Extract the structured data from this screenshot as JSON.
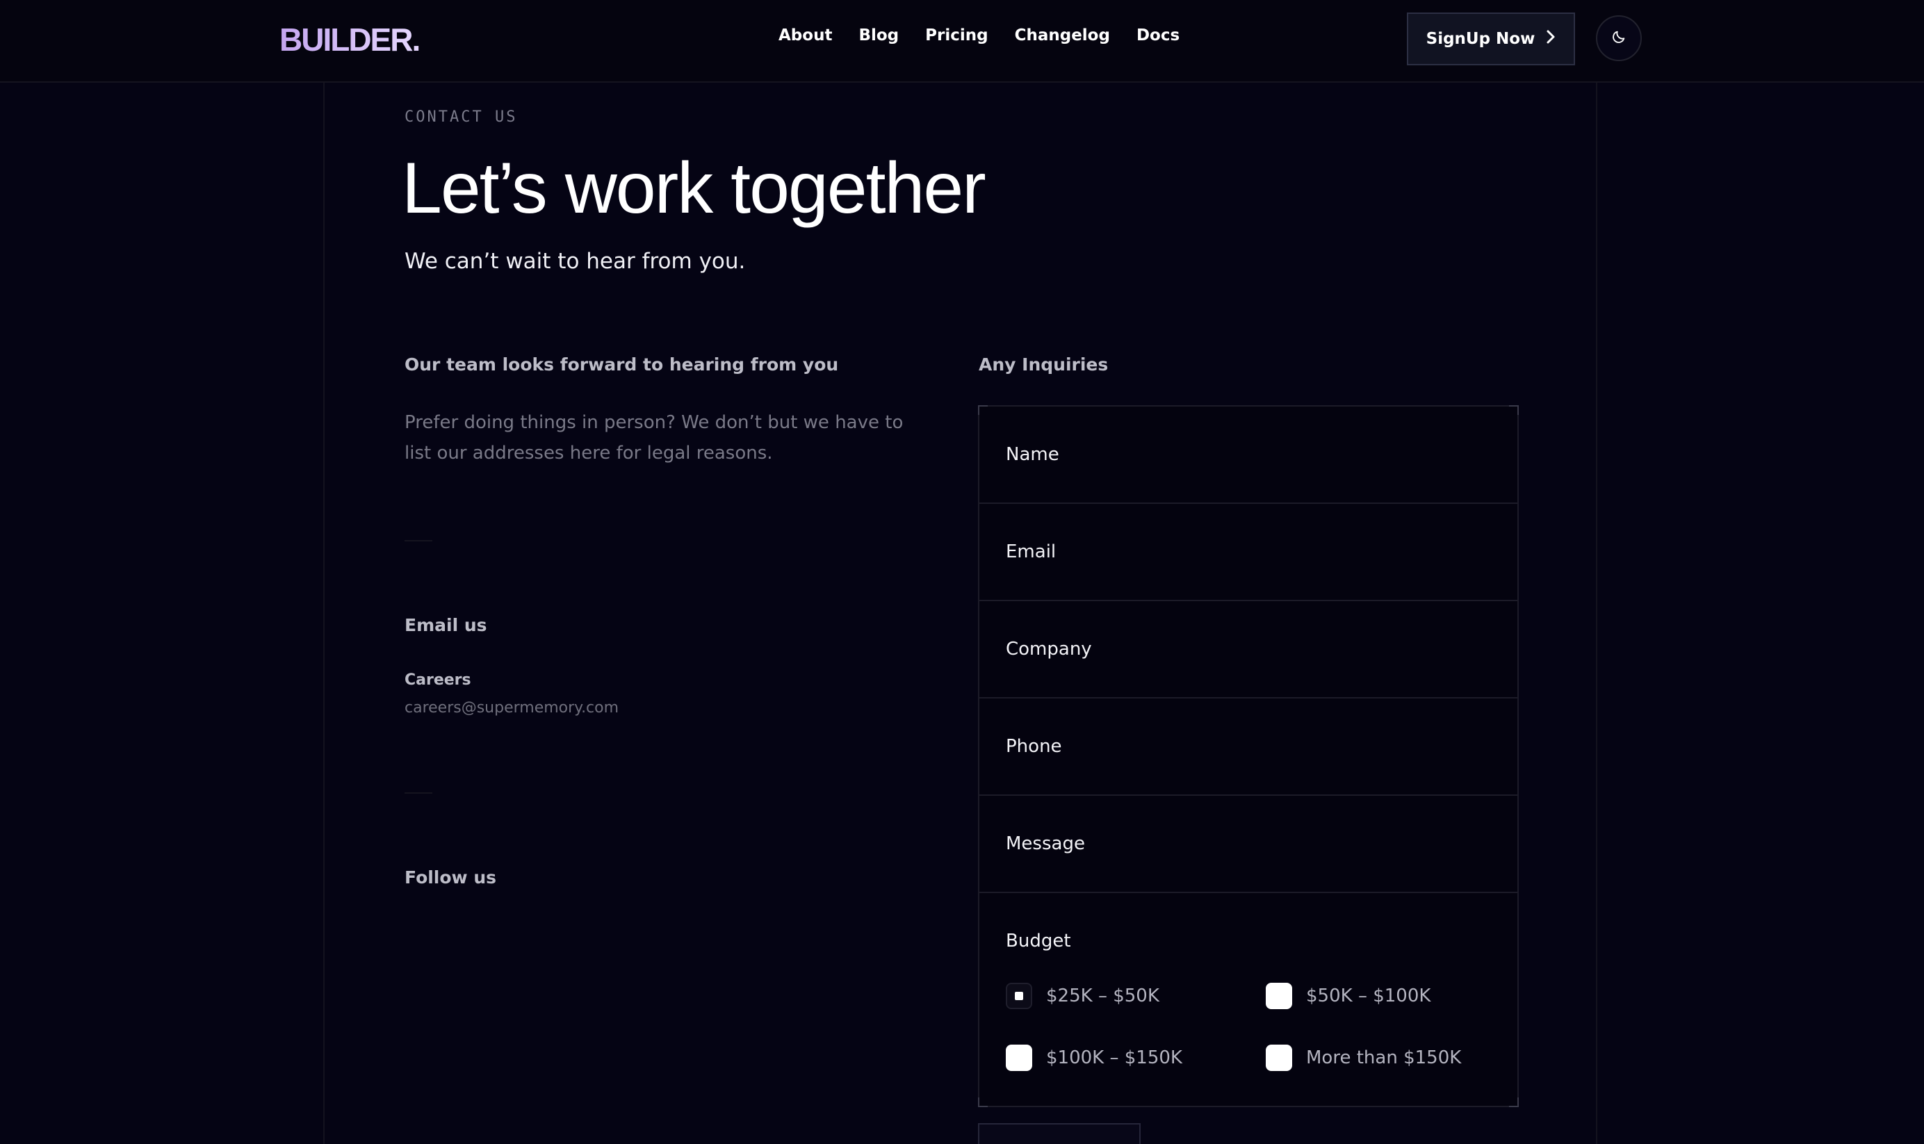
{
  "brand": {
    "logo": "BUILDER."
  },
  "nav": {
    "links": [
      "About",
      "Blog",
      "Pricing",
      "Changelog",
      "Docs"
    ],
    "signup_label": "SignUp Now"
  },
  "icons": {
    "theme_toggle": "moon-icon",
    "signup_arrow": "chevron-right-icon"
  },
  "hero": {
    "eyebrow": "CONTACT US",
    "title": "Let’s work together",
    "subtitle": "We can’t wait to hear from you."
  },
  "left": {
    "heading": "Our team looks forward to hearing from you",
    "description": "Prefer doing things in person? We don’t but we have to list our addresses here for legal reasons.",
    "email_heading": "Email us",
    "careers_label": "Careers",
    "careers_email": "careers@supermemory.com",
    "follow_heading": "Follow us"
  },
  "form": {
    "heading": "Any Inquiries",
    "fields": [
      "Name",
      "Email",
      "Company",
      "Phone",
      "Message"
    ],
    "budget_label": "Budget",
    "budget_options": [
      {
        "label": "$25K – $50K",
        "checked": true
      },
      {
        "label": "$50K – $100K",
        "checked": false
      },
      {
        "label": "$100K – $150K",
        "checked": false
      },
      {
        "label": "More than $150K",
        "checked": false
      }
    ]
  },
  "colors": {
    "background": "#050414",
    "accent": "#c4a5f0",
    "border": "#1c1b28"
  }
}
